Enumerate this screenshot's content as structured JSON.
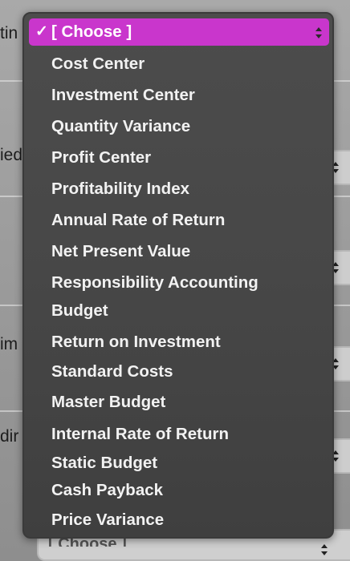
{
  "background": {
    "row_fragments": [
      "tin",
      "ied",
      "im",
      "dir"
    ],
    "bottom_select_value": "[ Choose ]"
  },
  "dropdown": {
    "selected_check": "✓",
    "selected_label": "[ Choose ]",
    "options": [
      "Cost Center",
      "Investment Center",
      "Quantity Variance",
      "Profit Center",
      "Profitability Index",
      "Annual Rate of Return",
      "Net Present Value",
      "Responsibility Accounting",
      "Budget",
      "Return on Investment",
      "Standard Costs",
      "Master Budget",
      "Internal Rate of Return",
      "Static Budget",
      "Cash Payback",
      "Price Variance"
    ]
  },
  "colors": {
    "highlight": "#c936cc",
    "menu_background": "#474747",
    "menu_text": "#f2f2f2"
  },
  "icons": {
    "selected_check": "checkmark-icon",
    "select_arrows": "updown-chevron-icon"
  }
}
